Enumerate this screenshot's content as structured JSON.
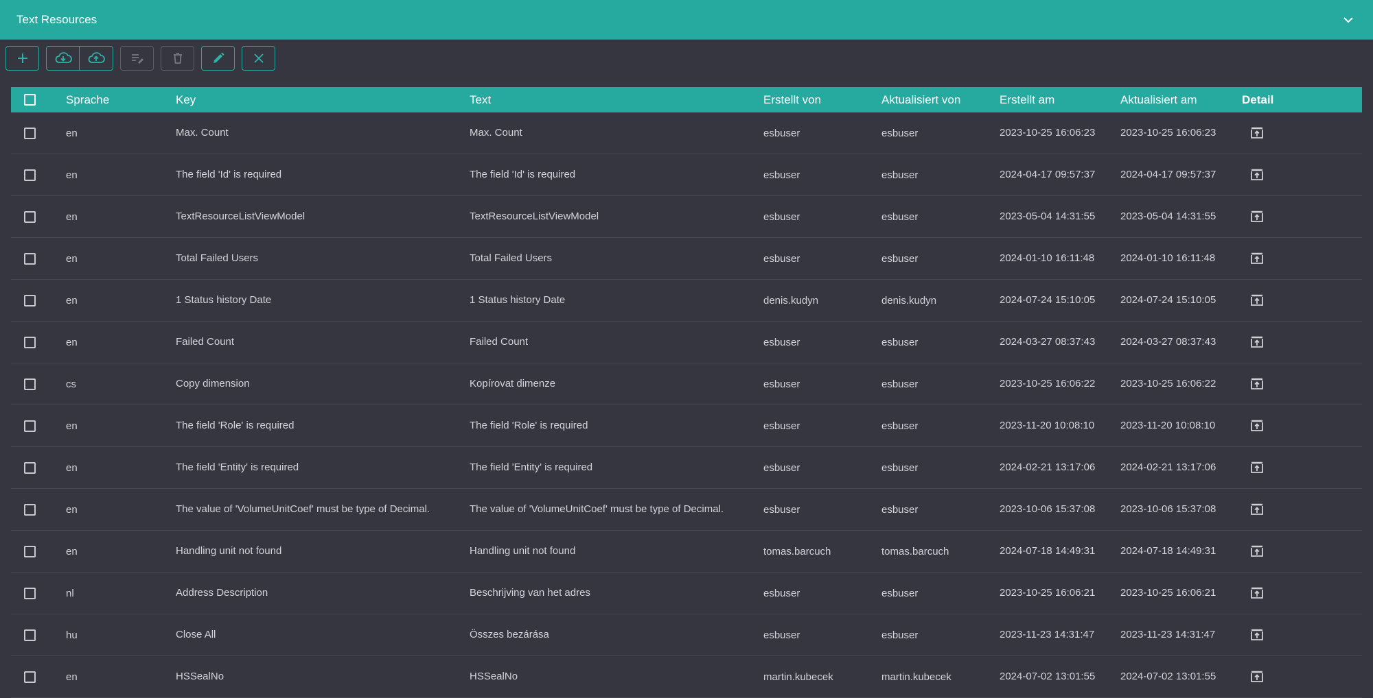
{
  "panel": {
    "title": "Text Resources"
  },
  "toolbar": {
    "buttons": [
      {
        "icon": "plus-icon"
      },
      {
        "icon": "cloud-download-icon"
      },
      {
        "icon": "cloud-upload-icon"
      },
      {
        "icon": "edit-list-icon"
      },
      {
        "icon": "trash-icon"
      },
      {
        "icon": "pencil-icon"
      },
      {
        "icon": "close-icon"
      }
    ]
  },
  "table": {
    "columns": {
      "language": "Sprache",
      "key": "Key",
      "text": "Text",
      "created_by": "Erstellt von",
      "updated_by": "Aktualisiert von",
      "created_at": "Erstellt am",
      "updated_at": "Aktualisiert am",
      "detail": "Detail"
    },
    "rows": [
      {
        "language": "en",
        "key": "Max. Count",
        "text": "Max. Count",
        "created_by": "esbuser",
        "updated_by": "esbuser",
        "created_at": "2023-10-25 16:06:23",
        "updated_at": "2023-10-25 16:06:23"
      },
      {
        "language": "en",
        "key": "The field 'Id' is required",
        "text": "The field 'Id' is required",
        "created_by": "esbuser",
        "updated_by": "esbuser",
        "created_at": "2024-04-17 09:57:37",
        "updated_at": "2024-04-17 09:57:37"
      },
      {
        "language": "en",
        "key": "TextResourceListViewModel",
        "text": "TextResourceListViewModel",
        "created_by": "esbuser",
        "updated_by": "esbuser",
        "created_at": "2023-05-04 14:31:55",
        "updated_at": "2023-05-04 14:31:55"
      },
      {
        "language": "en",
        "key": "Total Failed Users",
        "text": "Total Failed Users",
        "created_by": "esbuser",
        "updated_by": "esbuser",
        "created_at": "2024-01-10 16:11:48",
        "updated_at": "2024-01-10 16:11:48"
      },
      {
        "language": "en",
        "key": "1 Status history Date",
        "text": "1 Status history Date",
        "created_by": "denis.kudyn",
        "updated_by": "denis.kudyn",
        "created_at": "2024-07-24 15:10:05",
        "updated_at": "2024-07-24 15:10:05"
      },
      {
        "language": "en",
        "key": "Failed Count",
        "text": "Failed Count",
        "created_by": "esbuser",
        "updated_by": "esbuser",
        "created_at": "2024-03-27 08:37:43",
        "updated_at": "2024-03-27 08:37:43"
      },
      {
        "language": "cs",
        "key": "Copy dimension",
        "text": "Kopírovat dimenze",
        "created_by": "esbuser",
        "updated_by": "esbuser",
        "created_at": "2023-10-25 16:06:22",
        "updated_at": "2023-10-25 16:06:22"
      },
      {
        "language": "en",
        "key": "The field 'Role' is required",
        "text": "The field 'Role' is required",
        "created_by": "esbuser",
        "updated_by": "esbuser",
        "created_at": "2023-11-20 10:08:10",
        "updated_at": "2023-11-20 10:08:10"
      },
      {
        "language": "en",
        "key": "The field 'Entity' is required",
        "text": "The field 'Entity' is required",
        "created_by": "esbuser",
        "updated_by": "esbuser",
        "created_at": "2024-02-21 13:17:06",
        "updated_at": "2024-02-21 13:17:06"
      },
      {
        "language": "en",
        "key": "The value of 'VolumeUnitCoef' must be type of Decimal.",
        "text": "The value of 'VolumeUnitCoef' must be type of Decimal.",
        "created_by": "esbuser",
        "updated_by": "esbuser",
        "created_at": "2023-10-06 15:37:08",
        "updated_at": "2023-10-06 15:37:08"
      },
      {
        "language": "en",
        "key": "Handling unit not found",
        "text": "Handling unit not found",
        "created_by": "tomas.barcuch",
        "updated_by": "tomas.barcuch",
        "created_at": "2024-07-18 14:49:31",
        "updated_at": "2024-07-18 14:49:31"
      },
      {
        "language": "nl",
        "key": "Address Description",
        "text": "Beschrijving van het adres",
        "created_by": "esbuser",
        "updated_by": "esbuser",
        "created_at": "2023-10-25 16:06:21",
        "updated_at": "2023-10-25 16:06:21"
      },
      {
        "language": "hu",
        "key": "Close All",
        "text": "Összes bezárása",
        "created_by": "esbuser",
        "updated_by": "esbuser",
        "created_at": "2023-11-23 14:31:47",
        "updated_at": "2023-11-23 14:31:47"
      },
      {
        "language": "en",
        "key": "HSSealNo",
        "text": "HSSealNo",
        "created_by": "martin.kubecek",
        "updated_by": "martin.kubecek",
        "created_at": "2024-07-02 13:01:55",
        "updated_at": "2024-07-02 13:01:55"
      }
    ]
  }
}
